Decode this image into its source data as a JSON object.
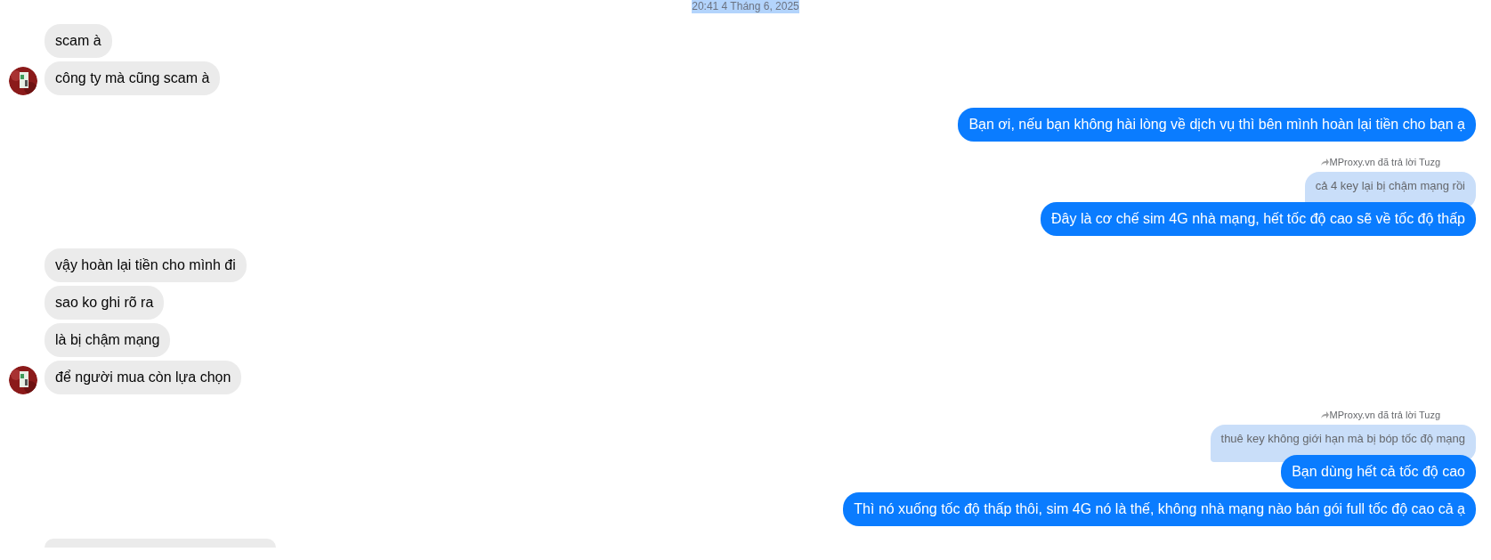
{
  "timestamp": "20:41 4 Tháng 6, 2025",
  "messages": [
    {
      "kind": "incoming",
      "text": "scam à",
      "avatar": false
    },
    {
      "kind": "incoming",
      "text": "công ty mà cũng scam à",
      "avatar": true
    },
    {
      "kind": "outgoing",
      "text": "Bạn ơi, nếu bạn không hài lòng về dịch vụ thì bên mình hoàn lại tiền cho bạn ạ"
    },
    {
      "kind": "reply",
      "label": "MProxy.vn đã trả lời Tuzg",
      "quoted": "cả 4 key lại bị chậm mạng rồi",
      "text": "Đây là cơ chế sim 4G nhà mạng, hết tốc độ cao sẽ về tốc độ thấp"
    },
    {
      "kind": "incoming",
      "text": "vậy hoàn lại tiền cho mình đi",
      "avatar": false
    },
    {
      "kind": "incoming",
      "text": "sao ko ghi rõ ra",
      "avatar": false
    },
    {
      "kind": "incoming",
      "text": "là bị chậm mạng",
      "avatar": false
    },
    {
      "kind": "incoming",
      "text": "để người mua còn lựa chọn",
      "avatar": true
    },
    {
      "kind": "reply",
      "label": "MProxy.vn đã trả lời Tuzg",
      "quoted": "thuê key không giới hạn mà bị bóp tốc độ mạng",
      "text": "Bạn dùng hết cả tốc độ cao"
    },
    {
      "kind": "outgoing",
      "text": "Thì nó xuống tốc độ thấp thôi, sim 4G nó là thế, không nhà mạng nào bán gói full tốc độ cao cả ạ"
    }
  ]
}
